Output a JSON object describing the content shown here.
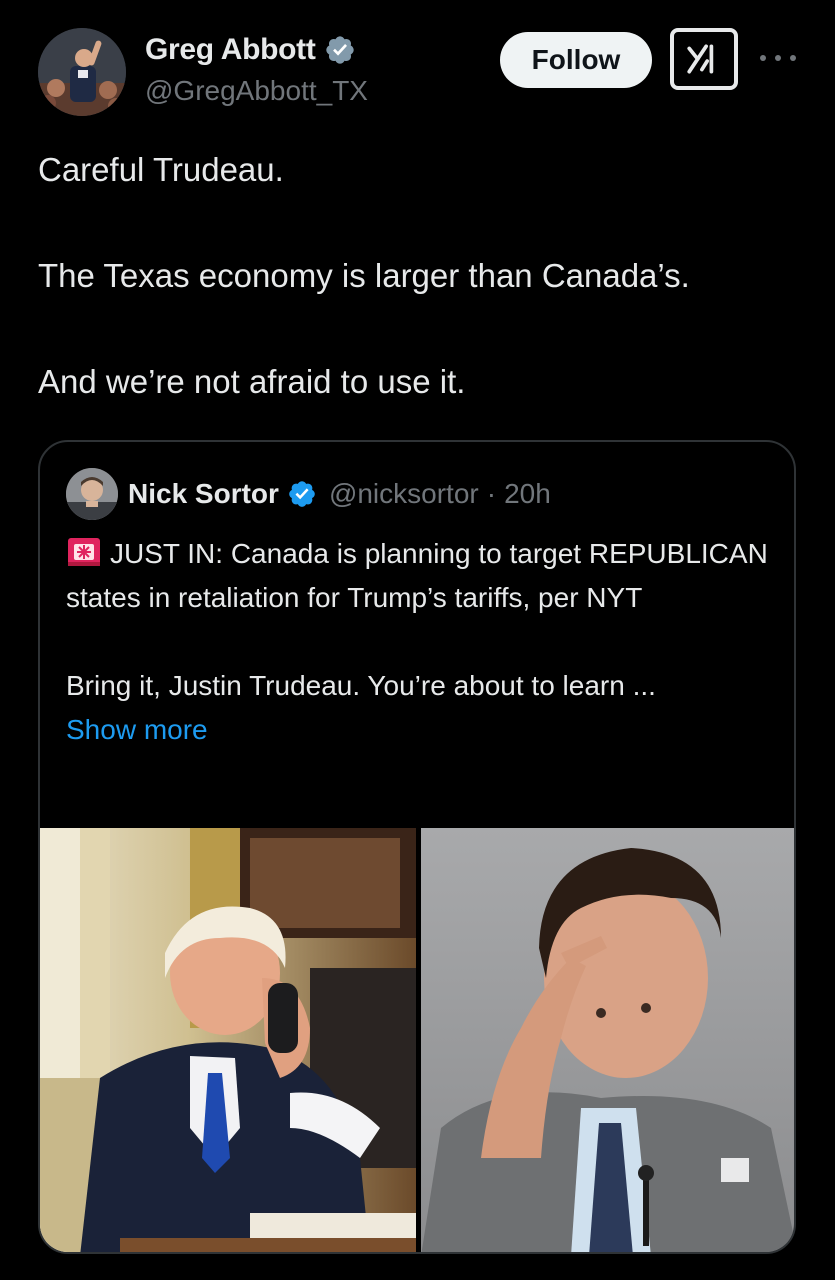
{
  "author": {
    "display_name": "Greg Abbott",
    "handle": "@GregAbbott_TX",
    "verified": true,
    "verified_color": "#829aab"
  },
  "actions": {
    "follow_label": "Follow",
    "grok_icon": "grok-icon",
    "more_icon": "more-options-icon"
  },
  "tweet": {
    "lines": [
      "Careful Trudeau.",
      "The Texas economy is larger than Canada’s.",
      "And we’re not afraid to use it."
    ]
  },
  "quote": {
    "display_name": "Nick Sortor",
    "handle": "@nicksortor",
    "separator": "·",
    "time": "20h",
    "verified_color": "#1d9bf0",
    "emoji_icon": "police-siren-icon",
    "text_para1": "JUST IN: Canada is planning to target REPUBLICAN states in retaliation for Trump’s tariffs, per NYT",
    "text_para2": "Bring it, Justin Trudeau. You’re about to learn ...",
    "show_more": "Show more",
    "link_color": "#1d9bf0"
  },
  "media": {
    "images": [
      {
        "name": "photo-man-on-phone"
      },
      {
        "name": "photo-man-touching-forehead"
      }
    ]
  },
  "colors": {
    "background": "#000000",
    "text_primary": "#e7e9ea",
    "text_secondary": "#71767b",
    "border": "#2f3336",
    "accent": "#1d9bf0"
  }
}
